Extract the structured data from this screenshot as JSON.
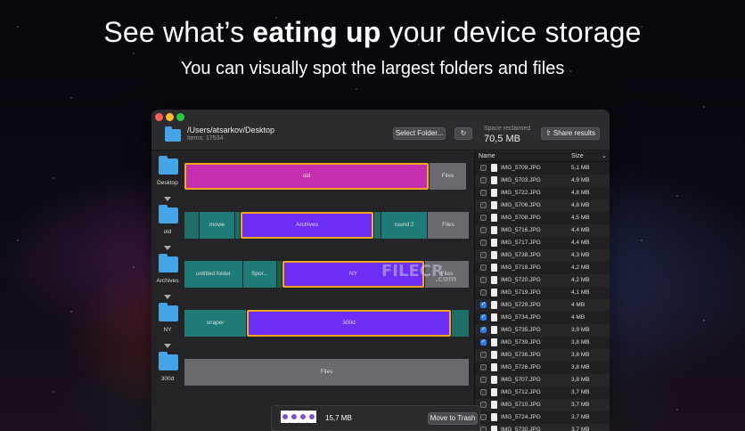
{
  "hero": {
    "headline_pre": "See what’s ",
    "headline_bold": "eating up",
    "headline_post": " your device storage",
    "subline": "You can visually spot the largest folders and files"
  },
  "toolbar": {
    "path": "/Users/atsarkov/Desktop",
    "items": "Items: 17534",
    "select_folder": "Select Folder...",
    "refresh_icon": "↻",
    "space_label": "Space reclaimed",
    "space_value": "70,5 MB",
    "share": "Share results"
  },
  "levels": [
    {
      "label": "Desktop"
    },
    {
      "label": "old"
    },
    {
      "label": "Archives"
    },
    {
      "label": "NY"
    },
    {
      "label": "300d"
    }
  ],
  "rows": [
    {
      "segments": [
        {
          "label": "old",
          "color": "#c42fb0",
          "selected": true
        },
        {
          "label": "Files",
          "color": "#6a6a6e"
        }
      ]
    },
    {
      "segments": [
        {
          "label": "",
          "color": "#1f6e6a"
        },
        {
          "label": "movie",
          "color": "#1f7b77"
        },
        {
          "label": "",
          "color": "#1f6e6a"
        },
        {
          "label": "Archives",
          "color": "#6c2ef5",
          "selected": true
        },
        {
          "label": "",
          "color": "#1f6e6a"
        },
        {
          "label": "round 2",
          "color": "#1f7b77"
        },
        {
          "label": "Files",
          "color": "#6a6a6e"
        }
      ]
    },
    {
      "segments": [
        {
          "label": "untitled folder",
          "color": "#1f7b77"
        },
        {
          "label": "Spor...",
          "color": "#1f7b77"
        },
        {
          "label": "",
          "color": "#1a5e3f"
        },
        {
          "label": "NY",
          "color": "#6c2ef5",
          "selected": true
        },
        {
          "label": "Files",
          "color": "#6a6a6e"
        }
      ]
    },
    {
      "segments": [
        {
          "label": "snaper",
          "color": "#1f7b77"
        },
        {
          "label": "300d",
          "color": "#6c2ef5",
          "selected": true
        },
        {
          "label": "",
          "color": "#1f6e6a"
        }
      ]
    },
    {
      "segments": [
        {
          "label": "Files",
          "color": "#6a6a6e"
        }
      ]
    }
  ],
  "list": {
    "col_name": "Name",
    "col_size": "Size",
    "files": [
      {
        "name": "IMG_5709.JPG",
        "size": "5,1 MB",
        "checked": false
      },
      {
        "name": "IMG_5703.JPG",
        "size": "4,9 MB",
        "checked": false
      },
      {
        "name": "IMG_5722.JPG",
        "size": "4,8 MB",
        "checked": false
      },
      {
        "name": "IMG_5706.JPG",
        "size": "4,8 MB",
        "checked": false
      },
      {
        "name": "IMG_5708.JPG",
        "size": "4,5 MB",
        "checked": false
      },
      {
        "name": "IMG_5716.JPG",
        "size": "4,4 MB",
        "checked": false
      },
      {
        "name": "IMG_5717.JPG",
        "size": "4,4 MB",
        "checked": false
      },
      {
        "name": "IMG_5738.JPG",
        "size": "4,3 MB",
        "checked": false
      },
      {
        "name": "IMG_5718.JPG",
        "size": "4,2 MB",
        "checked": false
      },
      {
        "name": "IMG_5720.JPG",
        "size": "4,2 MB",
        "checked": false
      },
      {
        "name": "IMG_5719.JPG",
        "size": "4,1 MB",
        "checked": false
      },
      {
        "name": "IMG_5729.JPG",
        "size": "4 MB",
        "checked": true
      },
      {
        "name": "IMG_5734.JPG",
        "size": "4 MB",
        "checked": true
      },
      {
        "name": "IMG_5735.JPG",
        "size": "3,9 MB",
        "checked": true
      },
      {
        "name": "IMG_5739.JPG",
        "size": "3,8 MB",
        "checked": true
      },
      {
        "name": "IMG_5736.JPG",
        "size": "3,8 MB",
        "checked": false
      },
      {
        "name": "IMG_5726.JPG",
        "size": "3,8 MB",
        "checked": false
      },
      {
        "name": "IMG_5707.JPG",
        "size": "3,8 MB",
        "checked": false
      },
      {
        "name": "IMG_5712.JPG",
        "size": "3,7 MB",
        "checked": false
      },
      {
        "name": "IMG_5710.JPG",
        "size": "3,7 MB",
        "checked": false
      },
      {
        "name": "IMG_5724.JPG",
        "size": "3,7 MB",
        "checked": false
      },
      {
        "name": "IMG_5730.JPG",
        "size": "3,7 MB",
        "checked": false
      }
    ]
  },
  "drop": {
    "size": "15,7 MB",
    "trash": "Move to Trash"
  },
  "watermark": {
    "main": "FILECR",
    "sub": ".com"
  }
}
